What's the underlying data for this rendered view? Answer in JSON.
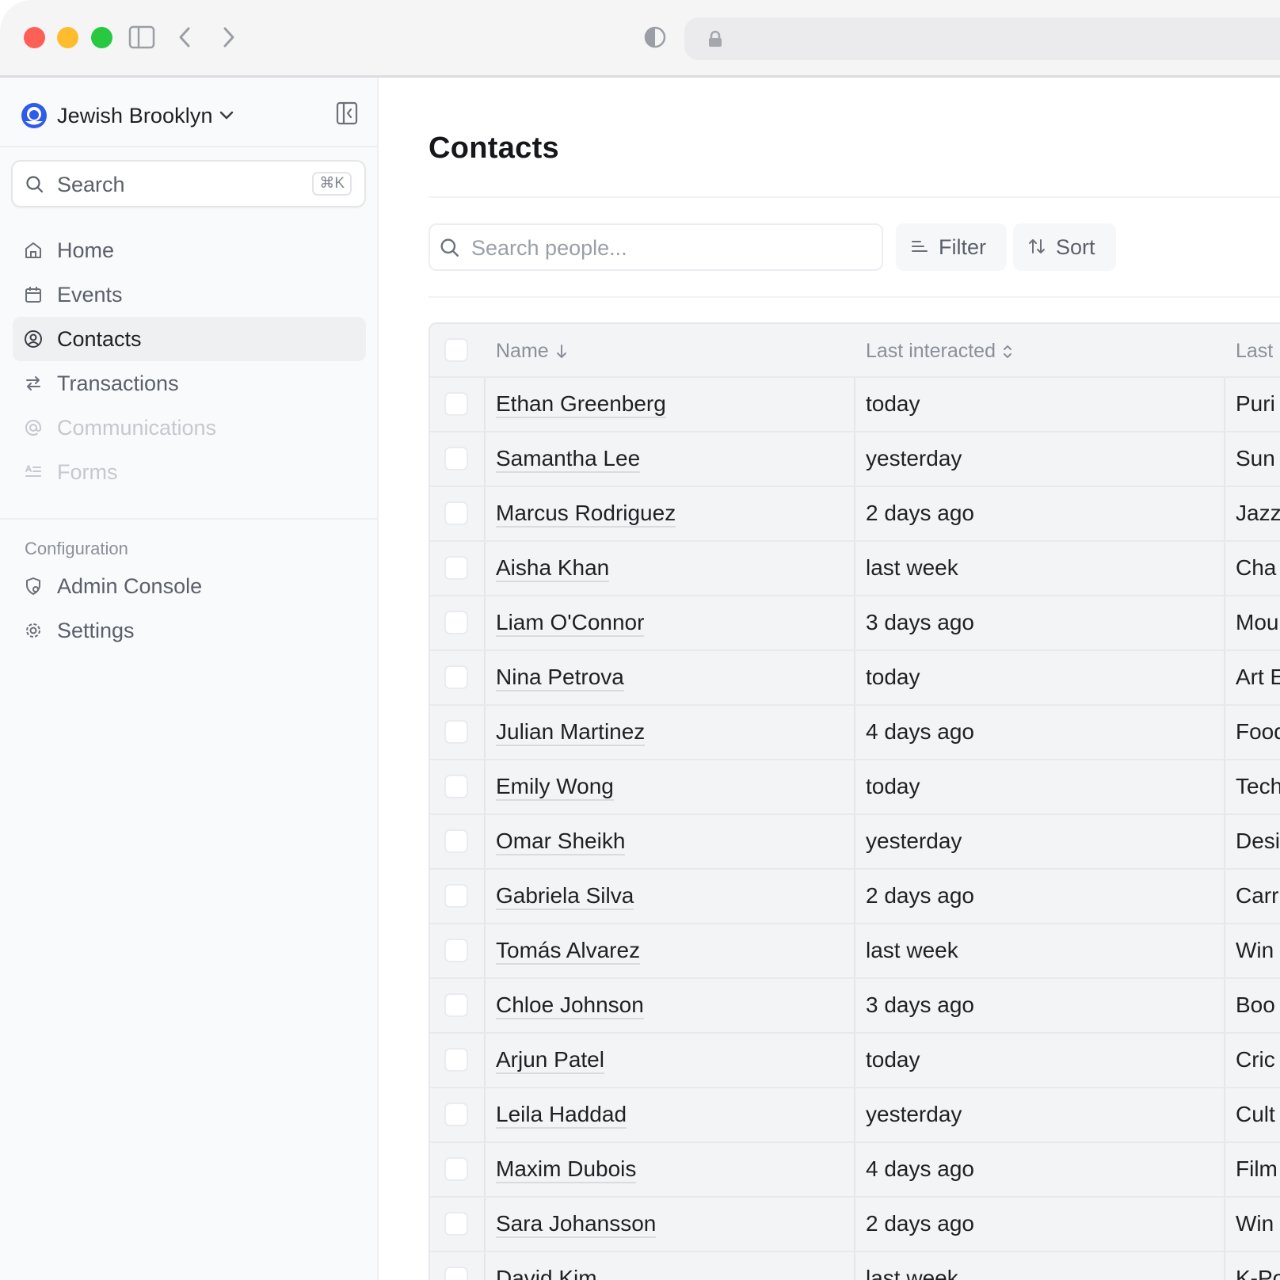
{
  "org": {
    "name": "Jewish Brooklyn"
  },
  "sidebar": {
    "search": {
      "label": "Search",
      "shortcut": "⌘K"
    },
    "nav": [
      {
        "label": "Home",
        "icon": "home-icon"
      },
      {
        "label": "Events",
        "icon": "calendar-icon"
      },
      {
        "label": "Contacts",
        "icon": "contact-icon",
        "active": true
      },
      {
        "label": "Transactions",
        "icon": "transfer-icon"
      },
      {
        "label": "Communications",
        "icon": "at-icon",
        "disabled": true
      },
      {
        "label": "Forms",
        "icon": "form-icon",
        "disabled": true
      }
    ],
    "config_section": {
      "label": "Configuration",
      "items": [
        {
          "label": "Admin Console",
          "icon": "shield-icon"
        },
        {
          "label": "Settings",
          "icon": "gear-icon"
        }
      ]
    }
  },
  "main": {
    "title": "Contacts",
    "search_placeholder": "Search people...",
    "filter_label": "Filter",
    "sort_label": "Sort"
  },
  "table": {
    "columns": [
      "Name",
      "Last interacted",
      "Last"
    ],
    "rows": [
      {
        "name": "Ethan Greenberg",
        "last_interacted": "today",
        "last": "Puri"
      },
      {
        "name": "Samantha Lee",
        "last_interacted": "yesterday",
        "last": "Sun"
      },
      {
        "name": "Marcus Rodriguez",
        "last_interacted": "2 days ago",
        "last": "Jazz"
      },
      {
        "name": "Aisha Khan",
        "last_interacted": "last week",
        "last": "Cha"
      },
      {
        "name": "Liam O'Connor",
        "last_interacted": "3 days ago",
        "last": "Mou"
      },
      {
        "name": "Nina Petrova",
        "last_interacted": "today",
        "last": "Art E"
      },
      {
        "name": "Julian Martinez",
        "last_interacted": "4 days ago",
        "last": "Food"
      },
      {
        "name": "Emily Wong",
        "last_interacted": "today",
        "last": "Tech"
      },
      {
        "name": "Omar Sheikh",
        "last_interacted": "yesterday",
        "last": "Desi"
      },
      {
        "name": "Gabriela Silva",
        "last_interacted": "2 days ago",
        "last": "Carr"
      },
      {
        "name": "Tomás Alvarez",
        "last_interacted": "last week",
        "last": "Win"
      },
      {
        "name": "Chloe Johnson",
        "last_interacted": "3 days ago",
        "last": "Boo"
      },
      {
        "name": "Arjun Patel",
        "last_interacted": "today",
        "last": "Cric"
      },
      {
        "name": "Leila Haddad",
        "last_interacted": "yesterday",
        "last": "Cult"
      },
      {
        "name": "Maxim Dubois",
        "last_interacted": "4 days ago",
        "last": "Film"
      },
      {
        "name": "Sara Johansson",
        "last_interacted": "2 days ago",
        "last": "Win"
      },
      {
        "name": "David Kim",
        "last_interacted": "last week",
        "last": "K-Po"
      }
    ]
  },
  "colors": {
    "accent": "#2f5bea",
    "traffic_red": "#fe5f57",
    "traffic_yellow": "#febc2e",
    "traffic_green": "#28c840"
  }
}
